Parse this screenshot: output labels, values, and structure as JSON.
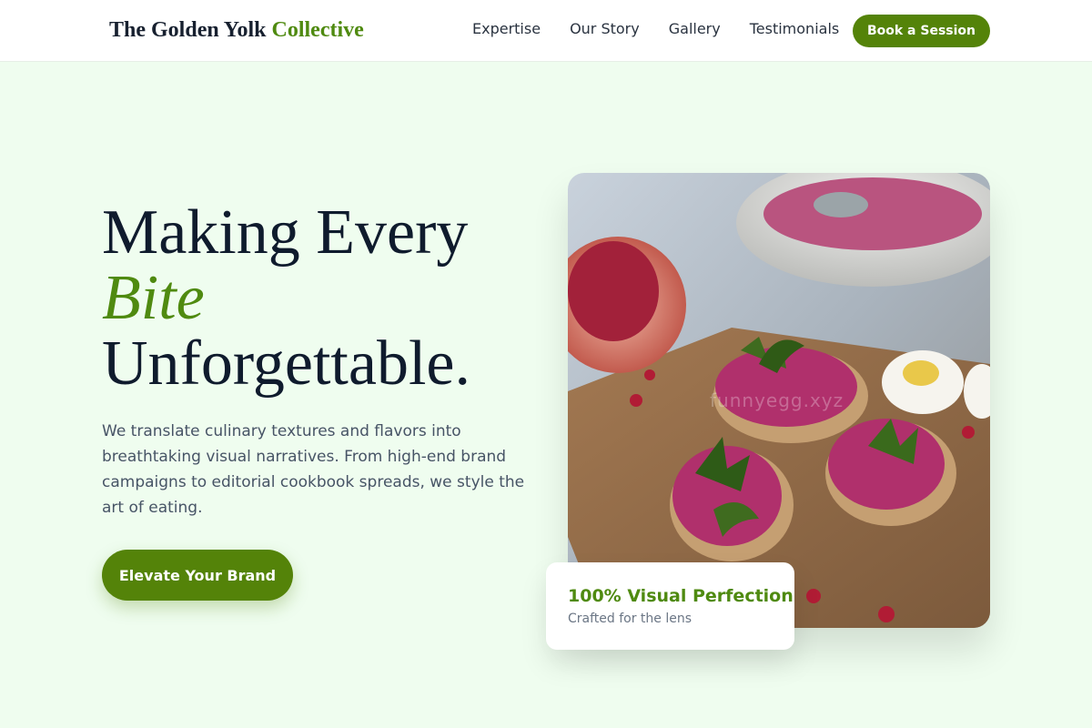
{
  "header": {
    "brand_primary": "The Golden Yolk",
    "brand_accent": "Collective",
    "nav": [
      "Expertise",
      "Our Story",
      "Gallery",
      "Testimonials"
    ],
    "cta_label": "Book a Session"
  },
  "hero": {
    "headline_line1": "Making Every",
    "headline_italic": "Bite",
    "headline_line3": "Unforgettable.",
    "description": "We translate culinary textures and flavors into breathtaking visual narratives. From high-end brand campaigns to editorial cookbook spreads, we style the art of eating.",
    "cta_label": "Elevate Your Brand",
    "image_watermark": "funnyegg.xyz"
  },
  "stat_card": {
    "title": "100% Visual Perfection",
    "subtitle": "Crafted for the lens"
  },
  "colors": {
    "accent": "#548309",
    "background": "#effdef",
    "text_dark": "#0f1b2d"
  }
}
